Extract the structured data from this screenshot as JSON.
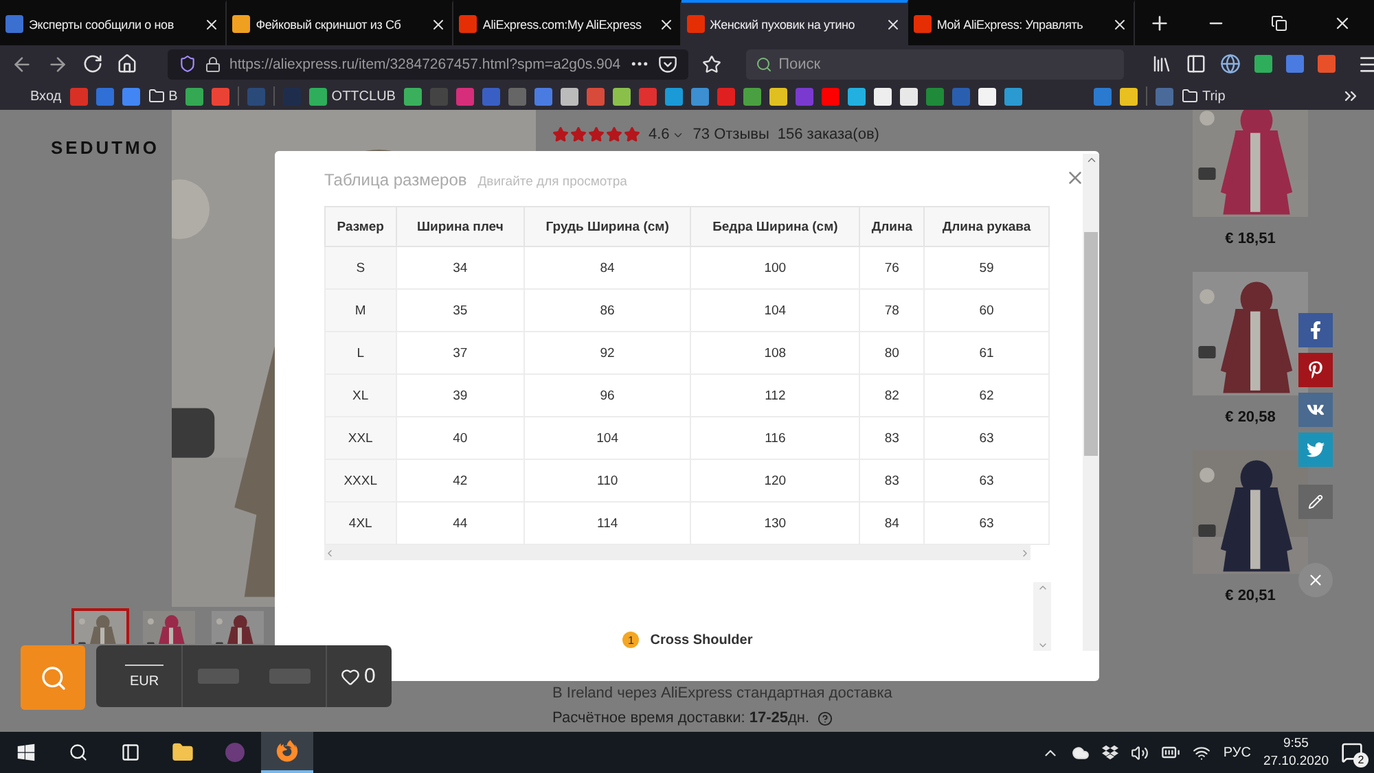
{
  "browser": {
    "tabs": [
      {
        "title": "Эксперты сообщили о нов",
        "selected": false
      },
      {
        "title": "Фейковый скриншот из Сб",
        "selected": false
      },
      {
        "title": "AliExpress.com:My AliExpress",
        "selected": false
      },
      {
        "title": "Женский пуховик на утино",
        "selected": true
      },
      {
        "title": "Мой AliExpress: Управлять",
        "selected": false
      }
    ],
    "address": "https://aliexpress.ru/item/32847267457.html?spm=a2g0s.904",
    "search": {
      "placeholder": "Поиск"
    },
    "bookmarks": [
      {
        "kind": "label",
        "label": "Вход"
      },
      {
        "kind": "icon",
        "color": "#d93025"
      },
      {
        "kind": "icon",
        "color": "#2f6fd6"
      },
      {
        "kind": "icon",
        "color": "#4285f4"
      },
      {
        "kind": "folder",
        "label": "В"
      },
      {
        "kind": "icon",
        "color": "#34a853"
      },
      {
        "kind": "icon",
        "color": "#ea4335"
      },
      {
        "kind": "separator"
      },
      {
        "kind": "icon",
        "color": "#2a4a7a"
      },
      {
        "kind": "separator"
      },
      {
        "kind": "icon",
        "color": "#1f2d4d"
      },
      {
        "kind": "app",
        "label": "OTTCLUB",
        "color": "#2eae5a"
      },
      {
        "kind": "icon",
        "color": "#3bb05c"
      },
      {
        "kind": "icon",
        "color": "#444444"
      },
      {
        "kind": "icon",
        "color": "#d62e7a"
      },
      {
        "kind": "icon",
        "color": "#3a5fc4"
      },
      {
        "kind": "icon",
        "color": "#666666"
      },
      {
        "kind": "icon",
        "color": "#4a7be0"
      },
      {
        "kind": "icon",
        "color": "#bbbbbb"
      },
      {
        "kind": "icon",
        "color": "#d84a3a"
      },
      {
        "kind": "icon",
        "color": "#8ac04a"
      },
      {
        "kind": "icon",
        "color": "#e03030"
      },
      {
        "kind": "icon",
        "color": "#1a9ad6"
      },
      {
        "kind": "icon",
        "color": "#3c8fd0"
      },
      {
        "kind": "icon",
        "color": "#e02020"
      },
      {
        "kind": "icon",
        "color": "#4aa040"
      },
      {
        "kind": "icon",
        "color": "#e0c020"
      },
      {
        "kind": "icon",
        "color": "#7a3ad0"
      },
      {
        "kind": "icon",
        "color": "#ff0000"
      },
      {
        "kind": "icon",
        "color": "#22b0e0"
      },
      {
        "kind": "icon",
        "color": "#eeeeee"
      },
      {
        "kind": "icon",
        "color": "#e8e8e8"
      },
      {
        "kind": "icon",
        "color": "#1f8a3a"
      },
      {
        "kind": "icon",
        "color": "#2a5fb0"
      },
      {
        "kind": "icon",
        "color": "#f2f2f2"
      },
      {
        "kind": "icon",
        "color": "#2a9ad0"
      },
      {
        "kind": "gap"
      },
      {
        "kind": "icon",
        "color": "#2a7ad0"
      },
      {
        "kind": "icon",
        "color": "#e8c020"
      },
      {
        "kind": "separator"
      },
      {
        "kind": "icon",
        "color": "#4a6a9a"
      },
      {
        "kind": "folder",
        "label": "Trip"
      }
    ]
  },
  "product": {
    "brand": "SEDUTMO",
    "rating": {
      "stars": 5,
      "score": "4.6",
      "reviews": "73 Отзывы",
      "orders": "156 заказа(ов)"
    },
    "thumbnails": [
      {
        "selected": true
      },
      {
        "selected": false
      },
      {
        "selected": false
      }
    ],
    "delivery": "В Ireland через AliExpress стандартная доставка",
    "delivery_time": "Расчётное время доставки: **17-25**дн."
  },
  "recommended": [
    {
      "price": "€ 18,51"
    },
    {
      "price": "€ 20,58"
    },
    {
      "price": "€ 20,51"
    }
  ],
  "size_chart": {
    "title": "Таблица размеров",
    "hint": "Двигайте для просмотра",
    "columns": [
      "Размер",
      "Ширина плеч",
      "Грудь Ширина (см)",
      "Бедра Ширина (см)",
      "Длина",
      "Длина рукава"
    ],
    "rows": [
      [
        "S",
        "34",
        "84",
        "100",
        "76",
        "59"
      ],
      [
        "M",
        "35",
        "86",
        "104",
        "78",
        "60"
      ],
      [
        "L",
        "37",
        "92",
        "108",
        "80",
        "61"
      ],
      [
        "XL",
        "39",
        "96",
        "112",
        "82",
        "62"
      ],
      [
        "XXL",
        "40",
        "104",
        "116",
        "83",
        "63"
      ],
      [
        "XXXL",
        "42",
        "110",
        "120",
        "83",
        "63"
      ],
      [
        "4XL",
        "44",
        "114",
        "130",
        "84",
        "63"
      ]
    ],
    "option": {
      "badge": "1",
      "label": "Cross Shoulder"
    }
  },
  "toolbar": {
    "currency": "EUR",
    "wishlist_count": "0"
  },
  "taskbar": {
    "language": "РУС",
    "time": "9:55",
    "date": "27.10.2020",
    "notifications": "2"
  }
}
